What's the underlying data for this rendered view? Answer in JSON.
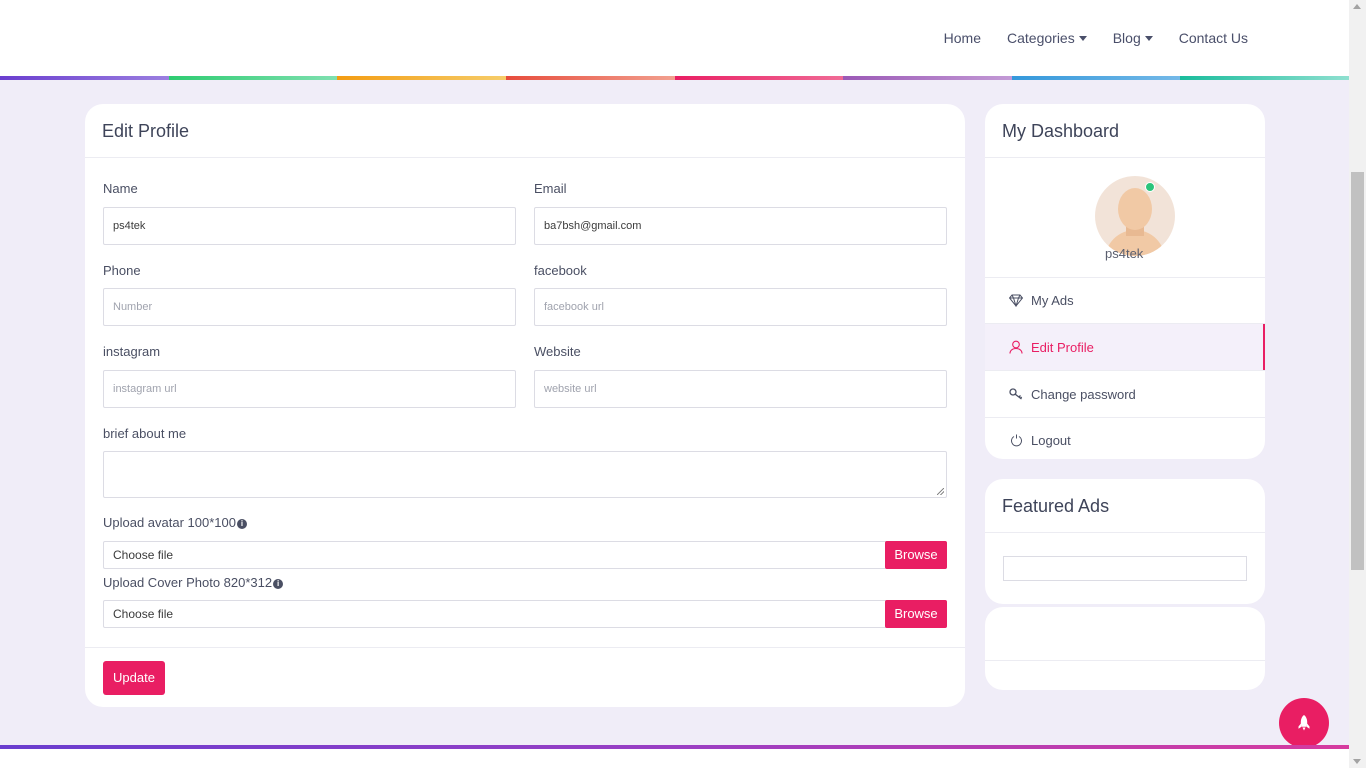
{
  "nav": {
    "items": [
      {
        "label": "Home",
        "dropdown": false
      },
      {
        "label": "Categories",
        "dropdown": true
      },
      {
        "label": "Blog",
        "dropdown": true
      },
      {
        "label": "Contact Us",
        "dropdown": false
      }
    ]
  },
  "colors": {
    "accent": "#e91e63",
    "header_stripe": [
      "#6a3ecf",
      "#2ecc71",
      "#f39c12",
      "#e74c3c",
      "#e91e63",
      "#9b59b6",
      "#3498db",
      "#1abc9c"
    ]
  },
  "edit_profile": {
    "title": "Edit Profile",
    "fields": {
      "name": {
        "label": "Name",
        "value": "ps4tek",
        "placeholder": ""
      },
      "email": {
        "label": "Email",
        "value": "ba7bsh@gmail.com",
        "placeholder": ""
      },
      "phone": {
        "label": "Phone",
        "value": "",
        "placeholder": "Number"
      },
      "facebook": {
        "label": "facebook",
        "value": "",
        "placeholder": "facebook url"
      },
      "instagram": {
        "label": "instagram",
        "value": "",
        "placeholder": "instagram url"
      },
      "website": {
        "label": "Website",
        "value": "",
        "placeholder": "website url"
      },
      "about": {
        "label": "brief about me",
        "value": ""
      }
    },
    "avatar_upload": {
      "label": "Upload avatar 100*100",
      "file_text": "Choose file",
      "button": "Browse"
    },
    "cover_upload": {
      "label": "Upload Cover Photo 820*312",
      "file_text": "Choose file",
      "button": "Browse"
    },
    "update_button": "Update"
  },
  "dashboard": {
    "title": "My Dashboard",
    "user_name": "ps4tek",
    "menu": [
      {
        "label": "My Ads",
        "icon": "diamond-icon",
        "active": false
      },
      {
        "label": "Edit Profile",
        "icon": "user-icon",
        "active": true
      },
      {
        "label": "Change password",
        "icon": "key-icon",
        "active": false
      },
      {
        "label": "Logout",
        "icon": "power-icon",
        "active": false
      }
    ]
  },
  "featured_ads": {
    "title": "Featured Ads"
  }
}
